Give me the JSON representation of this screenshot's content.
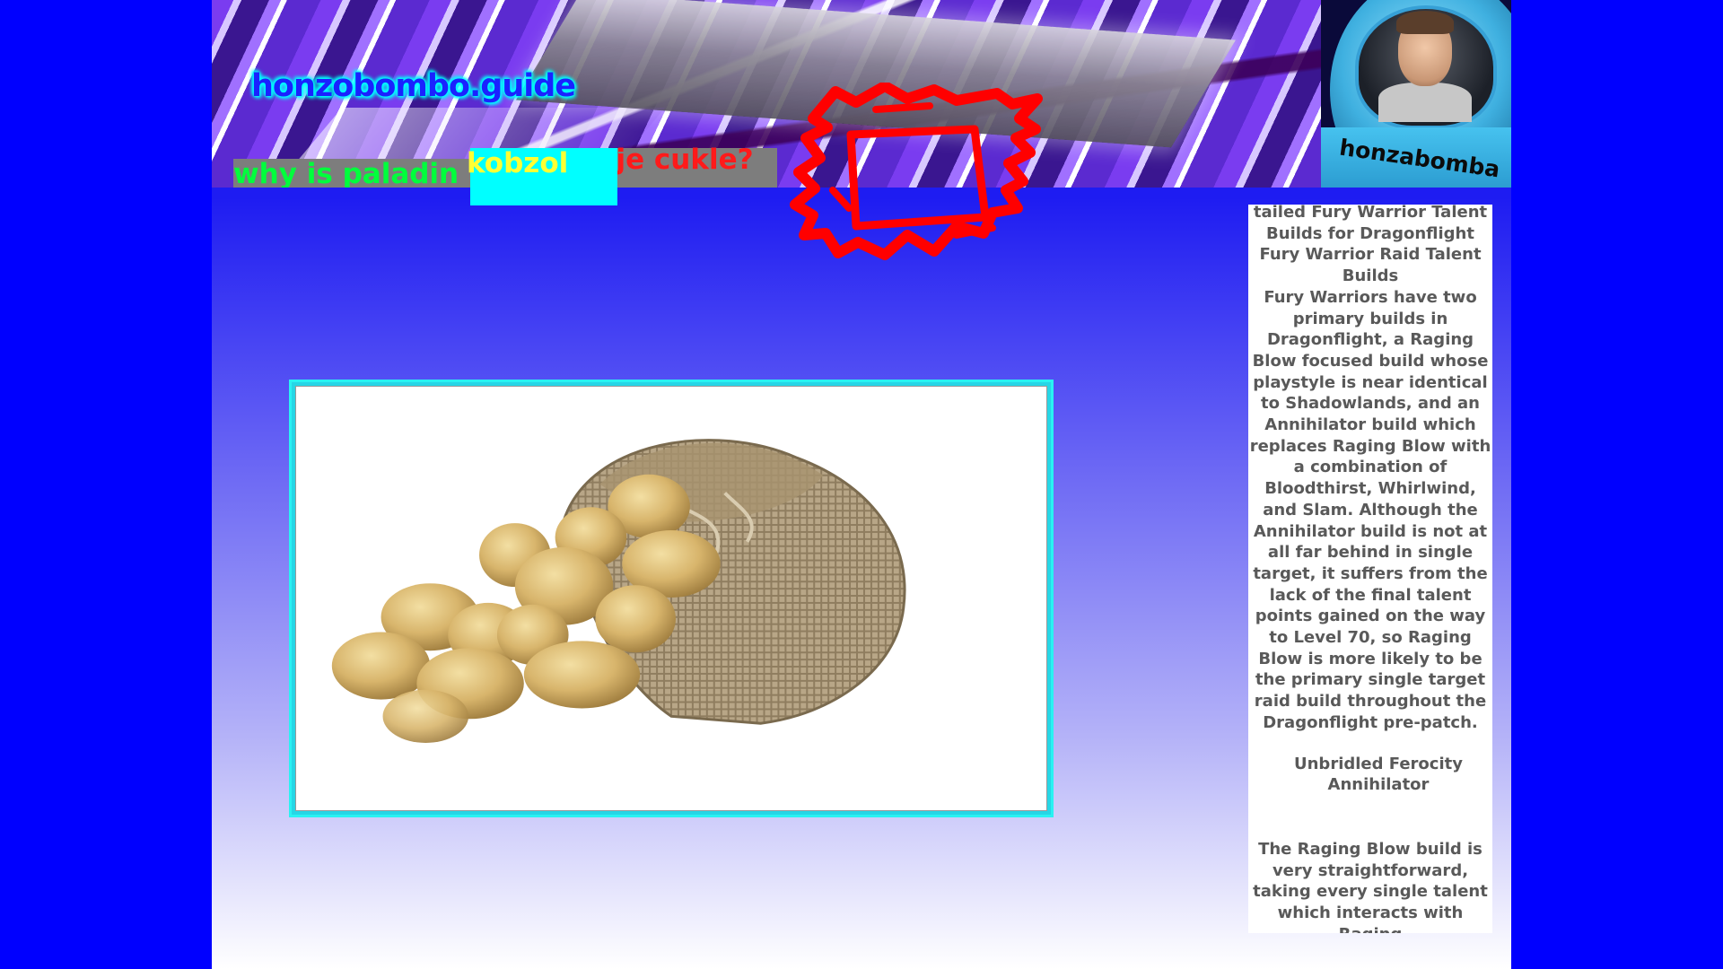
{
  "site": {
    "logo": "honzobombo.guide",
    "avatar_label": "honzabomba"
  },
  "nav": {
    "paladin": "why is paladin bad?",
    "cukle": "co je cukle?",
    "kobzol": "kobzol"
  },
  "image": {
    "alt": "sack of potatoes"
  },
  "guide": {
    "heading_partial": "tailed Fury Warrior Talent Builds for Dragonflight",
    "subheading": "Fury Warrior Raid Talent Builds",
    "para1": "Fury Warriors have two primary builds in Dragonflight, a Raging Blow focused build whose playstyle is near identical to Shadowlands, and an Annihilator build which replaces Raging Blow with a combination of Bloodthirst, Whirlwind, and Slam. Although the Annihilator build is not at all far behind in single target, it suffers from the lack of the final talent points gained on the way to Level 70, so Raging Blow is more likely to be the primary single target raid build throughout the Dragonflight pre-patch.",
    "ability1": "Unbridled Ferocity",
    "ability2": "Annihilator",
    "para3": "The Raging Blow build is very straightforward, taking every single talent which interacts with Raging"
  },
  "colors": {
    "background": "#0000ff",
    "logo_text": "#1a22ff",
    "logo_glow": "#00ffff",
    "nav_button_bg": "#7d7d7d",
    "nav_paladin_text": "#00ff3c",
    "nav_cukle_text": "#ff1a1a",
    "nav_kobzol_bg": "#00ffff",
    "nav_kobzol_text": "#ffff33",
    "scribble": "#ff0000",
    "image_border": "#29f2f2",
    "panel_text": "#595959"
  }
}
